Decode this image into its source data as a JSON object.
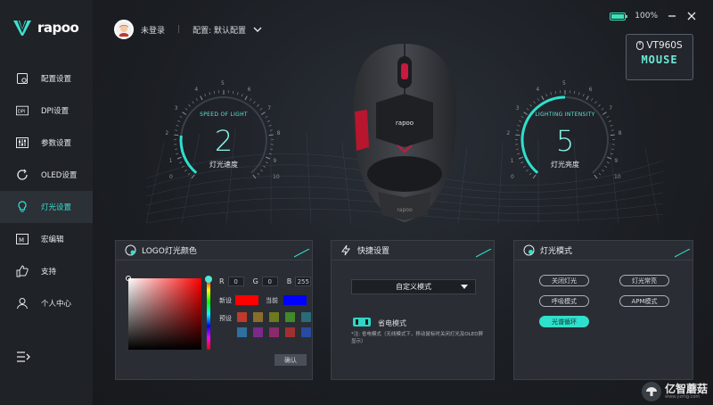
{
  "app": {
    "brand_name": "rapoo"
  },
  "sidebar": {
    "items": [
      {
        "label": "配置设置",
        "icon": "profile-icon"
      },
      {
        "label": "DPI设置",
        "icon": "dpi-icon"
      },
      {
        "label": "参数设置",
        "icon": "sliders-icon"
      },
      {
        "label": "OLED设置",
        "icon": "oled-icon"
      },
      {
        "label": "灯光设置",
        "icon": "lightbulb-icon",
        "active": true
      },
      {
        "label": "宏编辑",
        "icon": "macro-icon"
      },
      {
        "label": "支持",
        "icon": "thumbs-up-icon"
      },
      {
        "label": "个人中心",
        "icon": "user-icon"
      }
    ]
  },
  "header": {
    "login_status": "未登录",
    "profile_label": "配置: 默认配置",
    "battery": "100%"
  },
  "device": {
    "model": "VT960S",
    "type": "MOUSE"
  },
  "gauges": {
    "speed": {
      "caption": "SPEED OF LIGHT",
      "value": "2",
      "label": "灯光速度",
      "min": "0",
      "max": "10",
      "ticks": [
        "0",
        "1",
        "2",
        "3",
        "4",
        "5",
        "6",
        "7",
        "8",
        "9",
        "10"
      ],
      "level": 0.2
    },
    "intensity": {
      "caption": "LIGHTING INTENSITY",
      "value": "5",
      "label": "灯光亮度",
      "min": "0",
      "max": "10",
      "ticks": [
        "0",
        "1",
        "2",
        "3",
        "4",
        "5",
        "6",
        "7",
        "8",
        "9",
        "10"
      ],
      "level": 0.5
    }
  },
  "logo_color": {
    "title": "LOGO灯光颜色",
    "r_label": "R",
    "r": "0",
    "g_label": "G",
    "g": "0",
    "b_label": "B",
    "b": "255",
    "new_label": "新设",
    "current_label": "当前",
    "preset_label": "预设",
    "new_color": "#ff0000",
    "current_color": "#0000ff",
    "presets": [
      "#c0392b",
      "#8a6d2a",
      "#6b7a1f",
      "#3f8a2a",
      "#2a6b7a",
      "#2f6fa0",
      "#7a2a8a",
      "#8a2a6a",
      "#a03030",
      "#2a4aa0"
    ],
    "confirm": "确认"
  },
  "shortcut": {
    "title": "快捷设置",
    "mode_select": "自定义模式",
    "power_save": "省电模式",
    "note": "*注: 省电模式（无线模式下，移动鼠标时关闭灯光及OLED屏显示）"
  },
  "light_mode": {
    "title": "灯光模式",
    "modes": [
      "关闭灯光",
      "灯光常亮",
      "呼吸模式",
      "APM模式",
      "光谱循环"
    ]
  },
  "watermark": {
    "text": "亿智蘑菇",
    "url": "www.yzmg.com"
  },
  "colors": {
    "accent": "#2fe0cc",
    "sidebar_active_bg": "#2c3037",
    "panel_bg": "#2a2e34"
  }
}
